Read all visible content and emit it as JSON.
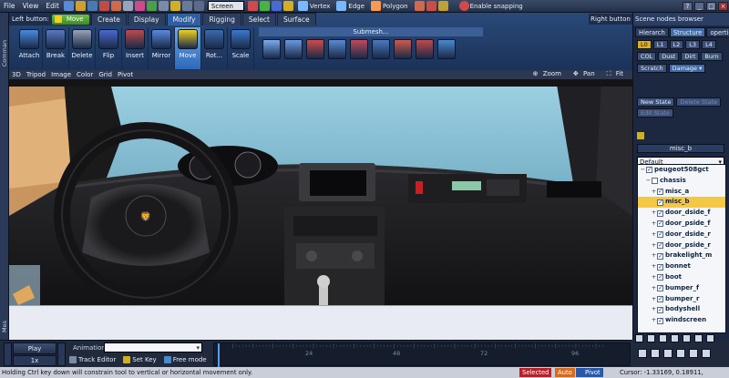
{
  "menu": {
    "items": [
      "File",
      "View",
      "Edit"
    ],
    "screen_select": "Screen",
    "modes": [
      {
        "label": "Vertex",
        "icon": "vertex-icon",
        "color": "#7ab8ff"
      },
      {
        "label": "Edge",
        "icon": "edge-icon",
        "color": "#7ab8ff"
      },
      {
        "label": "Polygon",
        "icon": "polygon-icon",
        "color": "#ff9a4a"
      }
    ],
    "enable_snapping": "Enable snapping"
  },
  "ribbon": {
    "left_button_label": "Left button:",
    "left_button_value": "Move",
    "tabs": [
      {
        "label": "Create",
        "active": false
      },
      {
        "label": "Display",
        "active": false
      },
      {
        "label": "Modify",
        "active": true
      },
      {
        "label": "Rigging",
        "active": false
      },
      {
        "label": "Select",
        "active": false
      },
      {
        "label": "Surface",
        "active": false
      }
    ],
    "right_button": "Right button",
    "tools": [
      {
        "label": "Attach",
        "icon": "attach-icon",
        "color": "#4a8ae0",
        "active": false
      },
      {
        "label": "Break",
        "icon": "break-icon",
        "color": "#5a7ac0",
        "active": false
      },
      {
        "label": "Delete",
        "icon": "delete-icon",
        "color": "#9aa4b8",
        "active": false
      },
      {
        "label": "Flip",
        "icon": "flip-icon",
        "color": "#4a6ad0",
        "active": false
      },
      {
        "label": "Insert",
        "icon": "insert-icon",
        "color": "#c04a4a",
        "active": false
      },
      {
        "label": "Mirror",
        "icon": "mirror-icon",
        "color": "#5a8ae0",
        "active": false
      },
      {
        "label": "Move",
        "icon": "move-icon",
        "color": "#f0d020",
        "active": true
      },
      {
        "label": "Rot...",
        "icon": "rotate-icon",
        "color": "#3a6ab0",
        "active": false
      },
      {
        "label": "Scale",
        "icon": "scale-icon",
        "color": "#3a7ad0",
        "active": false
      }
    ],
    "submesh_title": "Submesh...",
    "submesh_icons": [
      {
        "icon": "submesh-cube-icon",
        "color": "#7aaaf0"
      },
      {
        "icon": "submesh-edit-icon",
        "color": "#6a9ae0"
      },
      {
        "icon": "submesh-scatter-icon",
        "color": "#d04a4a"
      },
      {
        "icon": "submesh-split-icon",
        "color": "#5a8ad0"
      },
      {
        "icon": "submesh-extrude-icon",
        "color": "#c04a5a"
      },
      {
        "icon": "submesh-weld-icon",
        "color": "#4a7ac0"
      },
      {
        "icon": "submesh-detach-icon",
        "color": "#d05a4a"
      },
      {
        "icon": "submesh-merge-icon",
        "color": "#c04a4a"
      },
      {
        "icon": "submesh-smooth-icon",
        "color": "#4a8ad0"
      }
    ]
  },
  "left_strip": {
    "top_label": "Comman",
    "bottom_label": "Mes"
  },
  "viewport": {
    "toolbar": [
      "3D",
      "Tripod",
      "Image",
      "Color",
      "Grid",
      "Pivot"
    ],
    "right": [
      "Zoom",
      "Pan",
      "Fit"
    ]
  },
  "animation": {
    "play": "Play",
    "speed": "1x",
    "label": "Animation:",
    "track_editor": "Track Editor",
    "set_key": "Set Key",
    "free_mode": "Free mode",
    "ticks": [
      "24",
      "48",
      "72",
      "96"
    ]
  },
  "status": {
    "message": "Holding Ctrl key down will constrain tool to vertical or horizontal movement only.",
    "selected": "Selected",
    "auto": "Auto",
    "pivot": "Pivot",
    "cursor": "Cursor: -1.33169, 0.18911, -1.37309"
  },
  "right_panel": {
    "title": "Scene nodes browser",
    "tabs": [
      {
        "label": "Hierarch",
        "active": false
      },
      {
        "label": "Structure",
        "active": true
      },
      {
        "label": "operties",
        "active": false
      }
    ],
    "lod_row": [
      "L0",
      "L1",
      "L2",
      "L3",
      "L4"
    ],
    "row2": [
      "COL",
      "Dust",
      "Dirt",
      "Burn"
    ],
    "row3": [
      "Scratch",
      "Damage"
    ],
    "new_state": "New State",
    "delete_state": "Delete State",
    "edit_state": "Edit State",
    "misc_box": "misc_b",
    "default_select": "Default",
    "tree": [
      {
        "label": "peugeot508gct",
        "indent": 0,
        "exp": "−",
        "checked": true,
        "selected": false
      },
      {
        "label": "chassis",
        "indent": 1,
        "exp": "−",
        "checked": false,
        "selected": false
      },
      {
        "label": "misc_a",
        "indent": 2,
        "exp": "+",
        "checked": true,
        "selected": false
      },
      {
        "label": "misc_b",
        "indent": 2,
        "exp": "",
        "checked": true,
        "selected": true
      },
      {
        "label": "door_dside_f",
        "indent": 2,
        "exp": "+",
        "checked": true,
        "selected": false
      },
      {
        "label": "door_pside_f",
        "indent": 2,
        "exp": "+",
        "checked": true,
        "selected": false
      },
      {
        "label": "door_dside_r",
        "indent": 2,
        "exp": "+",
        "checked": true,
        "selected": false
      },
      {
        "label": "door_pside_r",
        "indent": 2,
        "exp": "+",
        "checked": true,
        "selected": false
      },
      {
        "label": "brakelight_m",
        "indent": 2,
        "exp": "+",
        "checked": true,
        "selected": false
      },
      {
        "label": "bonnet",
        "indent": 2,
        "exp": "+",
        "checked": true,
        "selected": false
      },
      {
        "label": "boot",
        "indent": 2,
        "exp": "+",
        "checked": true,
        "selected": false
      },
      {
        "label": "bumper_f",
        "indent": 2,
        "exp": "+",
        "checked": true,
        "selected": false
      },
      {
        "label": "bumper_r",
        "indent": 2,
        "exp": "+",
        "checked": true,
        "selected": false
      },
      {
        "label": "bodyshell",
        "indent": 2,
        "exp": "+",
        "checked": true,
        "selected": false
      },
      {
        "label": "windscreen",
        "indent": 2,
        "exp": "+",
        "checked": true,
        "selected": false
      }
    ]
  }
}
